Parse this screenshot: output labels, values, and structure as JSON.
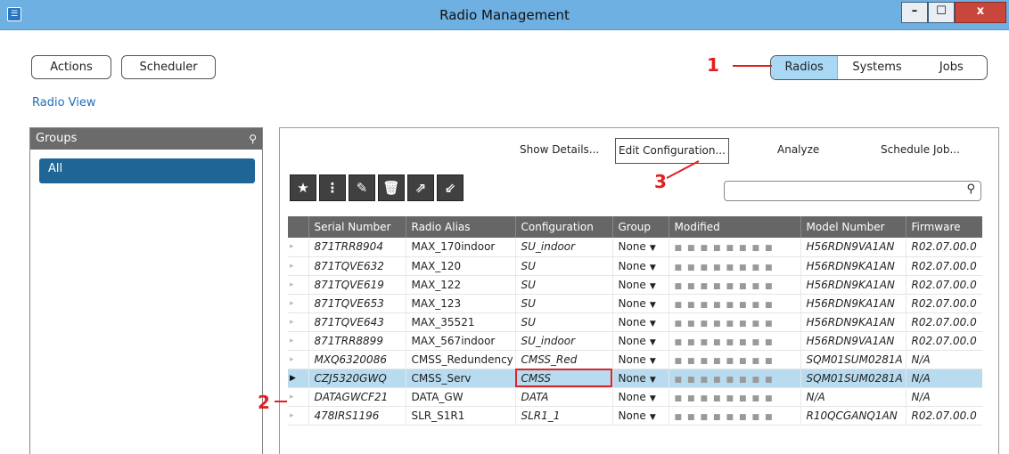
{
  "window": {
    "title": "Radio Management",
    "minimize": "–",
    "maximize": "☐",
    "close": "x"
  },
  "toolbar_top": {
    "actions": "Actions",
    "scheduler": "Scheduler"
  },
  "view_tabs": [
    "Radios",
    "Systems",
    "Jobs"
  ],
  "radio_view_link": "Radio View",
  "groups": {
    "header": "Groups",
    "items": [
      "All"
    ]
  },
  "commands": {
    "show_details": "Show Details...",
    "edit_configuration": "Edit Configuration...",
    "analyze": "Analyze",
    "schedule_job": "Schedule Job..."
  },
  "search": {
    "placeholder": ""
  },
  "annotations": [
    "1",
    "2",
    "3"
  ],
  "table": {
    "columns": [
      "Serial Number",
      "Radio Alias",
      "Configuration",
      "Group",
      "Modified",
      "Model Number",
      "Firmware"
    ],
    "rows": [
      {
        "serial": "871TRR8904",
        "alias": "MAX_170indoor",
        "config": "SU_indoor",
        "group": "None",
        "model": "H56RDN9VA1AN",
        "firmware": "R02.07.00.0"
      },
      {
        "serial": "871TQVE632",
        "alias": "MAX_120",
        "config": "SU",
        "group": "None",
        "model": "H56RDN9KA1AN",
        "firmware": "R02.07.00.0"
      },
      {
        "serial": "871TQVE619",
        "alias": "MAX_122",
        "config": "SU",
        "group": "None",
        "model": "H56RDN9KA1AN",
        "firmware": "R02.07.00.0"
      },
      {
        "serial": "871TQVE653",
        "alias": "MAX_123",
        "config": "SU",
        "group": "None",
        "model": "H56RDN9KA1AN",
        "firmware": "R02.07.00.0"
      },
      {
        "serial": "871TQVE643",
        "alias": "MAX_35521",
        "config": "SU",
        "group": "None",
        "model": "H56RDN9KA1AN",
        "firmware": "R02.07.00.0"
      },
      {
        "serial": "871TRR8899",
        "alias": "MAX_567indoor",
        "config": "SU_indoor",
        "group": "None",
        "model": "H56RDN9VA1AN",
        "firmware": "R02.07.00.0"
      },
      {
        "serial": "MXQ6320086",
        "alias": "CMSS_Redundency",
        "config": "CMSS_Red",
        "group": "None",
        "model": "SQM01SUM0281A",
        "firmware": "N/A"
      },
      {
        "serial": "CZJ5320GWQ",
        "alias": "CMSS_Serv",
        "config": "CMSS",
        "group": "None",
        "model": "SQM01SUM0281A",
        "firmware": "N/A",
        "selected": true
      },
      {
        "serial": "DATAGWCF21",
        "alias": "DATA_GW",
        "config": "DATA",
        "group": "None",
        "model": "N/A",
        "firmware": "N/A"
      },
      {
        "serial": "478IRS1196",
        "alias": "SLR_S1R1",
        "config": "SLR1_1",
        "group": "None",
        "model": "R10QCGANQ1AN",
        "firmware": "R02.07.00.0"
      }
    ]
  }
}
